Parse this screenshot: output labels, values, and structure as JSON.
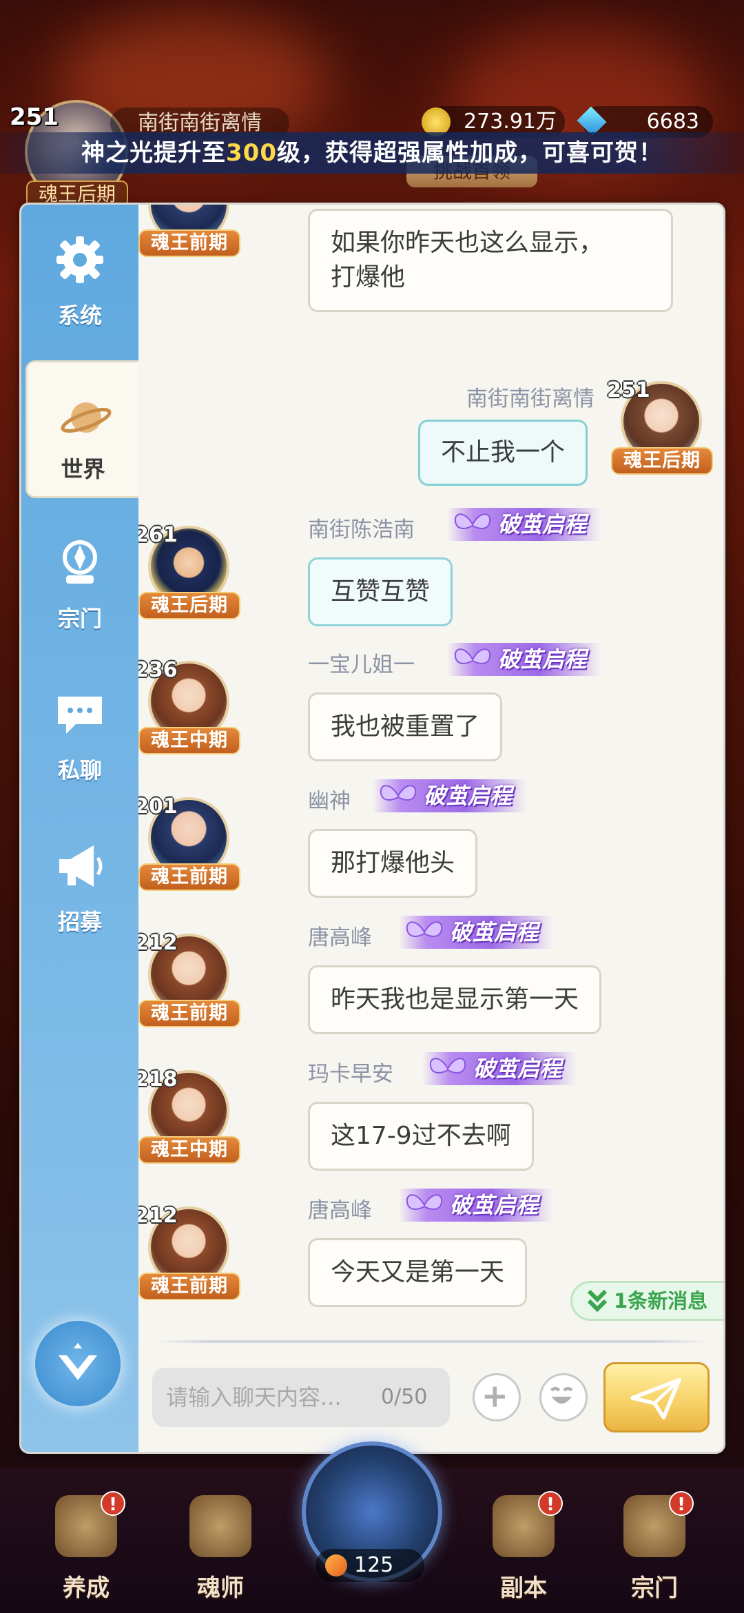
{
  "top": {
    "level": "251",
    "player_name": "南街南街离情",
    "rank": "魂王后期",
    "coins": "273.91万",
    "gems": "6683",
    "challenge_label": "挑战首领"
  },
  "broadcast": {
    "prefix": "神之光提升至",
    "highlight": "300",
    "suffix": "级，获得超强属性加成，可喜可贺！"
  },
  "sidebar": {
    "items": [
      {
        "label": "系统",
        "icon": "gear-icon"
      },
      {
        "label": "世界",
        "icon": "planet-icon"
      },
      {
        "label": "宗门",
        "icon": "sect-icon"
      },
      {
        "label": "私聊",
        "icon": "chat-bubble-icon"
      },
      {
        "label": "招募",
        "icon": "megaphone-icon"
      }
    ],
    "active": "世界"
  },
  "messages": [
    {
      "level": "",
      "rank": "魂王前期",
      "name": "",
      "badge": "",
      "text_line1": "如果你昨天也这么显示，",
      "text_line2": "打爆他",
      "side": "left"
    },
    {
      "level": "251",
      "rank": "魂王后期",
      "name": "南街南街离情",
      "badge": "",
      "text": "不止我一个",
      "side": "right"
    },
    {
      "level": "261",
      "rank": "魂王后期",
      "name": "南街陈浩南",
      "badge": "破茧启程",
      "text": "互赞互赞",
      "side": "left"
    },
    {
      "level": "236",
      "rank": "魂王中期",
      "name": "一宝儿姐一",
      "badge": "破茧启程",
      "text": "我也被重置了",
      "side": "left"
    },
    {
      "level": "201",
      "rank": "魂王前期",
      "name": "幽神",
      "badge": "破茧启程",
      "text": "那打爆他头",
      "side": "left"
    },
    {
      "level": "212",
      "rank": "魂王前期",
      "name": "唐高峰",
      "badge": "破茧启程",
      "text": "昨天我也是显示第一天",
      "side": "left"
    },
    {
      "level": "218",
      "rank": "魂王中期",
      "name": "玛卡早安",
      "badge": "破茧启程",
      "text": "这17-9过不去啊",
      "side": "left"
    },
    {
      "level": "212",
      "rank": "魂王前期",
      "name": "唐高峰",
      "badge": "破茧启程",
      "text": "今天又是第一天",
      "side": "left"
    }
  ],
  "new_messages": "1条新消息",
  "input": {
    "placeholder": "请输入聊天内容...",
    "count": "0/50"
  },
  "bottom_nav": [
    {
      "label": "养成",
      "badge": "!"
    },
    {
      "label": "魂师",
      "badge": ""
    },
    {
      "label": "125",
      "badge": ""
    },
    {
      "label": "副本",
      "badge": "!"
    },
    {
      "label": "宗门",
      "badge": "!"
    }
  ]
}
